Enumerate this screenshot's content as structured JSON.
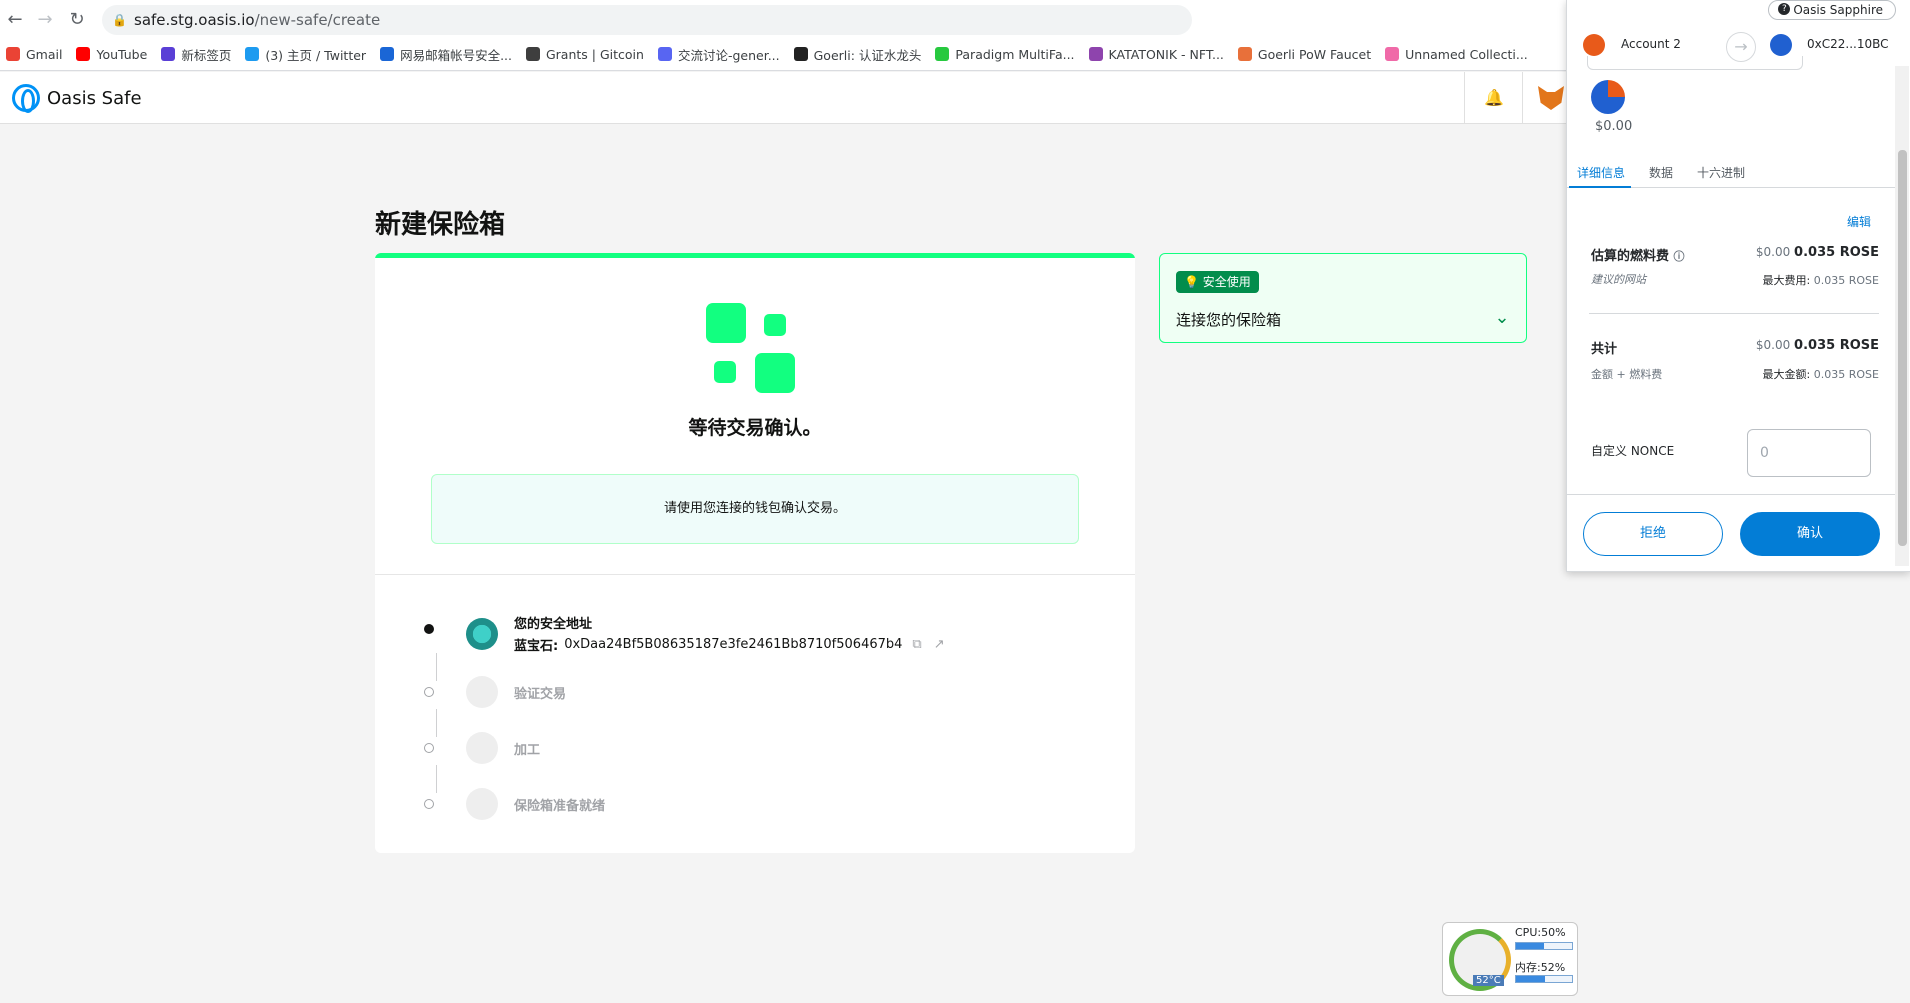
{
  "browser": {
    "url_host": "safe.stg.oasis.io",
    "url_path": "/new-safe/create",
    "bookmarks": [
      {
        "label": "Gmail",
        "color": "#ea4335"
      },
      {
        "label": "YouTube",
        "color": "#ff0000"
      },
      {
        "label": "新标签页",
        "color": "#5a3fd6"
      },
      {
        "label": "(3) 主页 / Twitter",
        "color": "#1d9bf0"
      },
      {
        "label": "网易邮箱帐号安全...",
        "color": "#1a66d6"
      },
      {
        "label": "Grants | Gitcoin",
        "color": "#3e3e3e"
      },
      {
        "label": "交流讨论-gener...",
        "color": "#5865f2"
      },
      {
        "label": "Goerli: 认证水龙头",
        "color": "#222222"
      },
      {
        "label": "Paradigm MultiFa...",
        "color": "#27c93f"
      },
      {
        "label": "KATATONIK - NFT...",
        "color": "#8e44ad"
      },
      {
        "label": "Goerli PoW Faucet",
        "color": "#e8703a"
      },
      {
        "label": "Unnamed Collecti...",
        "color": "#f06aa8"
      }
    ]
  },
  "app": {
    "name": "Oasis Safe",
    "page_title": "新建保险箱",
    "waiting_text": "等待交易确认。",
    "info_text": "请使用您连接的钱包确认交易。",
    "steps": [
      {
        "title": "您的安全地址",
        "address_label": "蓝宝石:",
        "address": "0xDaa24Bf5B08635187e3fe2461Bb8710f506467b4"
      },
      {
        "title": "验证交易"
      },
      {
        "title": "加工"
      },
      {
        "title": "保险箱准备就绪"
      }
    ],
    "tip_badge": "安全使用",
    "tip_title": "连接您的保险箱"
  },
  "metamask": {
    "network": "Oasis Sapphire",
    "from_account": "Account 2",
    "to_address": "0xC22...10BC",
    "amount": "$0.00",
    "tabs": [
      "详细信息",
      "数据",
      "十六进制"
    ],
    "edit": "编辑",
    "est_fee_label": "估算的燃料费",
    "est_fee_usd": "$0.00",
    "est_fee_rose": "0.035 ROSE",
    "suggested": "建议的网站",
    "max_fee_label": "最大费用:",
    "max_fee": "0.035 ROSE",
    "total_label": "共计",
    "total_usd": "$0.00",
    "total_rose": "0.035 ROSE",
    "amount_plus_fee": "金额 + 燃料费",
    "max_amount_label": "最大金额:",
    "max_amount": "0.035 ROSE",
    "nonce_label": "自定义 NONCE",
    "nonce_placeholder": "0",
    "reject": "拒绝",
    "confirm": "确认"
  },
  "monitor": {
    "cpu": "CPU:50%",
    "cpu_value": 0.5,
    "mem": "内存:52%",
    "mem_value": 0.52,
    "temp": "52°C"
  }
}
